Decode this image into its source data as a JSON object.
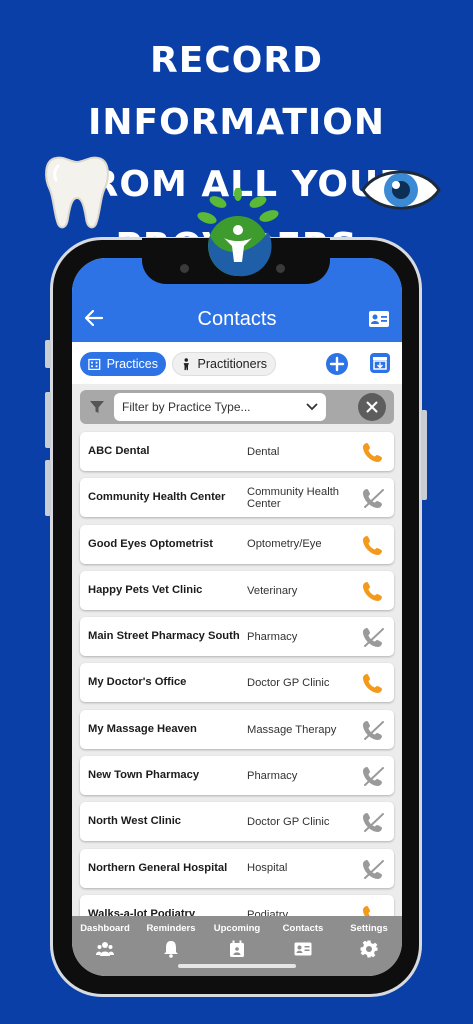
{
  "headline": [
    "RECORD INFORMATION",
    "FROM ALL YOUR",
    "PROVIDERS"
  ],
  "colors": {
    "background": "#0a3fa8",
    "app_blue": "#2d73e6",
    "call_active": "#f39a1c",
    "call_disabled": "#9a9a9a"
  },
  "appbar": {
    "title": "Contacts",
    "back_icon": "arrow-left-icon",
    "card_icon": "id-card-icon"
  },
  "tabs": [
    {
      "label": "Practices",
      "icon": "building-icon",
      "active": true
    },
    {
      "label": "Practitioners",
      "icon": "person-icon",
      "active": false
    }
  ],
  "filter": {
    "placeholder": "Filter by Practice Type..."
  },
  "contacts": [
    {
      "name": "ABC Dental",
      "type": "Dental",
      "call_enabled": true
    },
    {
      "name": "Community Health Center",
      "type": "Community Health Center",
      "call_enabled": false
    },
    {
      "name": "Good Eyes Optometrist",
      "type": "Optometry/Eye",
      "call_enabled": true
    },
    {
      "name": "Happy Pets Vet Clinic",
      "type": "Veterinary",
      "call_enabled": true
    },
    {
      "name": "Main Street Pharmacy South",
      "type": "Pharmacy",
      "call_enabled": false
    },
    {
      "name": "My Doctor's Office",
      "type": "Doctor GP Clinic",
      "call_enabled": true
    },
    {
      "name": "My Massage Heaven",
      "type": "Massage Therapy",
      "call_enabled": false
    },
    {
      "name": "New Town Pharmacy",
      "type": "Pharmacy",
      "call_enabled": false
    },
    {
      "name": "North West Clinic",
      "type": "Doctor GP Clinic",
      "call_enabled": false
    },
    {
      "name": "Northern General Hospital",
      "type": "Hospital",
      "call_enabled": false
    },
    {
      "name": "Walks-a-lot Podiatry",
      "type": "Podiatry",
      "call_enabled": true
    }
  ],
  "nav": [
    {
      "label": "Dashboard",
      "icon": "users-icon"
    },
    {
      "label": "Reminders",
      "icon": "bell-icon"
    },
    {
      "label": "Upcoming",
      "icon": "calendar-icon"
    },
    {
      "label": "Contacts",
      "icon": "contact-card-icon"
    },
    {
      "label": "Settings",
      "icon": "gear-icon"
    }
  ]
}
